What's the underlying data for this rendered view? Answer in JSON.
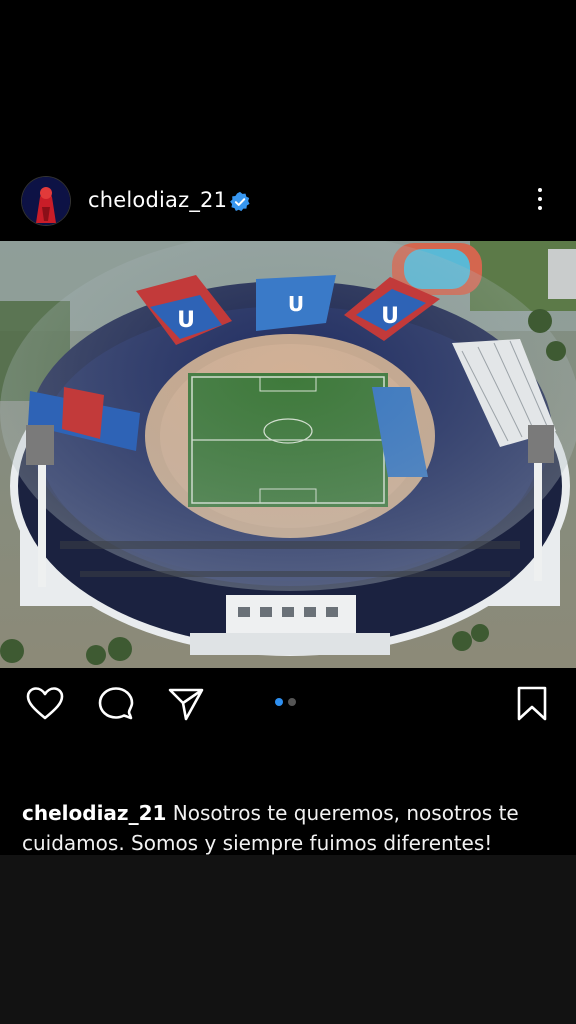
{
  "post": {
    "username": "chelodiaz_21",
    "verified_icon": "verified-badge-icon",
    "caption_user": "chelodiaz_21",
    "caption_text": "Nosotros te queremos, nosotros te cuidamos. Somos y siempre fuimos diferentes!",
    "media": {
      "description_icon": "stadium-photo",
      "carousel_total": 2,
      "carousel_index": 1
    }
  },
  "actions": {
    "like_icon": "heart-icon",
    "comment_icon": "comment-icon",
    "share_icon": "send-icon",
    "save_icon": "bookmark-icon",
    "more_icon": "more-vertical-icon"
  },
  "colors": {
    "background": "#000000",
    "verified": "#3897f0",
    "carousel_active": "#2e8ff0",
    "carousel_inactive": "#555555"
  }
}
